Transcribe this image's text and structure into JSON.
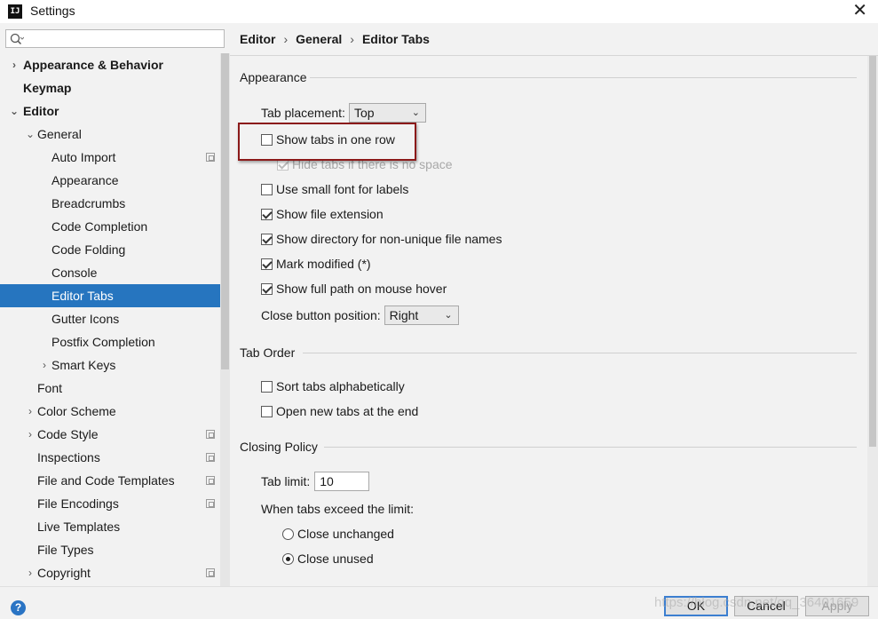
{
  "window": {
    "title": "Settings",
    "app_icon": "IJ",
    "close_glyph": "✕"
  },
  "search": {
    "value": "",
    "placeholder": ""
  },
  "tree": [
    {
      "label": "Appearance & Behavior",
      "level": 0,
      "bold": true,
      "expander": "›"
    },
    {
      "label": "Keymap",
      "level": 0,
      "bold": true,
      "expander": ""
    },
    {
      "label": "Editor",
      "level": 0,
      "bold": true,
      "expander": "⌄"
    },
    {
      "label": "General",
      "level": 1,
      "bold": false,
      "expander": "⌄"
    },
    {
      "label": "Auto Import",
      "level": 2,
      "bold": false,
      "expander": "",
      "project_icon": true
    },
    {
      "label": "Appearance",
      "level": 2,
      "bold": false,
      "expander": ""
    },
    {
      "label": "Breadcrumbs",
      "level": 2,
      "bold": false,
      "expander": ""
    },
    {
      "label": "Code Completion",
      "level": 2,
      "bold": false,
      "expander": ""
    },
    {
      "label": "Code Folding",
      "level": 2,
      "bold": false,
      "expander": ""
    },
    {
      "label": "Console",
      "level": 2,
      "bold": false,
      "expander": ""
    },
    {
      "label": "Editor Tabs",
      "level": 2,
      "bold": false,
      "expander": "",
      "selected": true
    },
    {
      "label": "Gutter Icons",
      "level": 2,
      "bold": false,
      "expander": ""
    },
    {
      "label": "Postfix Completion",
      "level": 2,
      "bold": false,
      "expander": ""
    },
    {
      "label": "Smart Keys",
      "level": 2,
      "bold": false,
      "expander": "›"
    },
    {
      "label": "Font",
      "level": 1,
      "bold": false,
      "expander": ""
    },
    {
      "label": "Color Scheme",
      "level": 1,
      "bold": false,
      "expander": "›"
    },
    {
      "label": "Code Style",
      "level": 1,
      "bold": false,
      "expander": "›",
      "project_icon": true
    },
    {
      "label": "Inspections",
      "level": 1,
      "bold": false,
      "expander": "",
      "project_icon": true
    },
    {
      "label": "File and Code Templates",
      "level": 1,
      "bold": false,
      "expander": "",
      "project_icon": true
    },
    {
      "label": "File Encodings",
      "level": 1,
      "bold": false,
      "expander": "",
      "project_icon": true
    },
    {
      "label": "Live Templates",
      "level": 1,
      "bold": false,
      "expander": ""
    },
    {
      "label": "File Types",
      "level": 1,
      "bold": false,
      "expander": ""
    },
    {
      "label": "Copyright",
      "level": 1,
      "bold": false,
      "expander": "›",
      "project_icon": true
    }
  ],
  "breadcrumb": {
    "items": [
      "Editor",
      "General",
      "Editor Tabs"
    ],
    "separator": "›"
  },
  "appearance": {
    "title": "Appearance",
    "tab_placement_label": "Tab placement:",
    "tab_placement_value": "Top",
    "show_tabs_one_row": {
      "label": "Show tabs in one row",
      "checked": false
    },
    "hide_tabs_no_space": {
      "label": "Hide tabs if there is no space",
      "checked": true,
      "disabled": true
    },
    "small_font": {
      "label": "Use small font for labels",
      "checked": false
    },
    "file_extension": {
      "label": "Show file extension",
      "checked": true
    },
    "directory_non_unique": {
      "label": "Show directory for non-unique file names",
      "checked": true
    },
    "mark_modified": {
      "label": "Mark modified (*)",
      "checked": true
    },
    "full_path_hover": {
      "label": "Show full path on mouse hover",
      "checked": true
    },
    "close_button_label": "Close button position:",
    "close_button_value": "Right"
  },
  "tab_order": {
    "title": "Tab Order",
    "sort_alpha": {
      "label": "Sort tabs alphabetically",
      "checked": false
    },
    "open_at_end": {
      "label": "Open new tabs at the end",
      "checked": false
    }
  },
  "closing_policy": {
    "title": "Closing Policy",
    "tab_limit_label": "Tab limit:",
    "tab_limit_value": "10",
    "exceed_label": "When tabs exceed the limit:",
    "close_unchanged": {
      "label": "Close unchanged",
      "checked": false
    },
    "close_unused": {
      "label": "Close unused",
      "checked": true
    }
  },
  "buttons": {
    "ok": "OK",
    "cancel": "Cancel",
    "apply": "Apply",
    "help": "?"
  },
  "watermark": "https://blog.csdn.net/qq_36401659",
  "colors": {
    "selection": "#2675bf",
    "highlight_border": "#8b1a1a",
    "help": "#2a74c4"
  }
}
